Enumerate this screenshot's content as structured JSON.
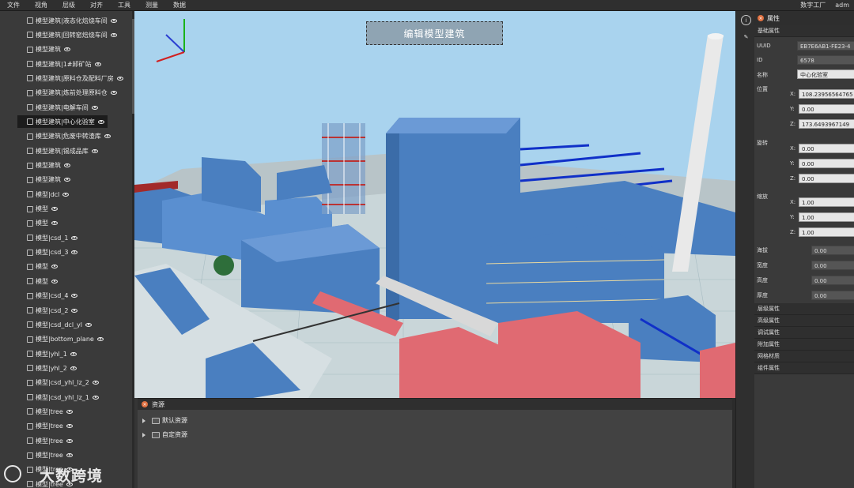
{
  "menu": [
    "文件",
    "视角",
    "层级",
    "对齐",
    "工具",
    "测量",
    "数据"
  ],
  "menu_right": [
    "数字工厂",
    "adm"
  ],
  "tree_items": [
    {
      "label": "模型建筑|液态化焙烧车间",
      "selected": false
    },
    {
      "label": "模型建筑|回转窑焙烧车间",
      "selected": false
    },
    {
      "label": "模型建筑",
      "selected": false
    },
    {
      "label": "模型建筑|1#卸矿站",
      "selected": false
    },
    {
      "label": "模型建筑|原料仓及配料厂房",
      "selected": false
    },
    {
      "label": "模型建筑|炼前处理原料仓",
      "selected": false
    },
    {
      "label": "模型建筑|电解车间",
      "selected": false
    },
    {
      "label": "模型建筑|中心化验室",
      "selected": true
    },
    {
      "label": "模型建筑|危废中转渣库",
      "selected": false
    },
    {
      "label": "模型建筑|锡成品库",
      "selected": false
    },
    {
      "label": "模型建筑",
      "selected": false
    },
    {
      "label": "模型建筑",
      "selected": false
    },
    {
      "label": "模型|dcl",
      "selected": false
    },
    {
      "label": "模型",
      "selected": false
    },
    {
      "label": "模型",
      "selected": false
    },
    {
      "label": "模型|csd_1",
      "selected": false
    },
    {
      "label": "模型|csd_3",
      "selected": false
    },
    {
      "label": "模型",
      "selected": false
    },
    {
      "label": "模型",
      "selected": false
    },
    {
      "label": "模型|csd_4",
      "selected": false
    },
    {
      "label": "模型|csd_2",
      "selected": false
    },
    {
      "label": "模型|csd_dcl_yl",
      "selected": false
    },
    {
      "label": "模型|bottom_plane",
      "selected": false
    },
    {
      "label": "模型|yhl_1",
      "selected": false
    },
    {
      "label": "模型|yhl_2",
      "selected": false
    },
    {
      "label": "模型|csd_yhl_lz_2",
      "selected": false
    },
    {
      "label": "模型|csd_yhl_lz_1",
      "selected": false
    },
    {
      "label": "模型|tree",
      "selected": false
    },
    {
      "label": "模型|tree",
      "selected": false
    },
    {
      "label": "模型|tree",
      "selected": false
    },
    {
      "label": "模型|tree",
      "selected": false
    },
    {
      "label": "模型|tree",
      "selected": false
    },
    {
      "label": "模型|tree",
      "selected": false
    }
  ],
  "viewport": {
    "banner": "编辑模型建筑"
  },
  "resources": {
    "title": "资源",
    "items": [
      "默认资源",
      "自定资源"
    ]
  },
  "properties": {
    "title": "属性",
    "basic_section": "基础属性",
    "uuid_label": "UUID",
    "uuid_value": "EB7E6AB1-FE23-4",
    "id_label": "ID",
    "id_value": "6578",
    "name_label": "名称",
    "name_value": "中心化验室",
    "position_label": "位置",
    "pos_x": "108.23956564765",
    "pos_y": "0.00",
    "pos_z": "173.6493967149",
    "rotation_label": "旋转",
    "rot_x": "0.00",
    "rot_y": "0.00",
    "rot_z": "0.00",
    "scale_label": "缩放",
    "sc_x": "1.00",
    "sc_y": "1.00",
    "sc_z": "1.00",
    "altitude_label": "海拔",
    "altitude_value": "0.00",
    "width_label": "宽度",
    "width_value": "0.00",
    "height_label": "高度",
    "height_value": "0.00",
    "thickness_label": "厚度",
    "thickness_value": "0.00",
    "axis_x": "X:",
    "axis_y": "Y:",
    "axis_z": "Z:",
    "sections": [
      "层级属性",
      "高级属性",
      "调试属性",
      "附加属性",
      "网格材质",
      "组件属性"
    ]
  },
  "watermark": "大数跨境",
  "colors": {
    "sky": "#a9d3ee",
    "building": "#4a7fc0",
    "red_pipe": "#e06a72",
    "panel_dark": "#2b2b2b",
    "accent": "#e07040"
  }
}
